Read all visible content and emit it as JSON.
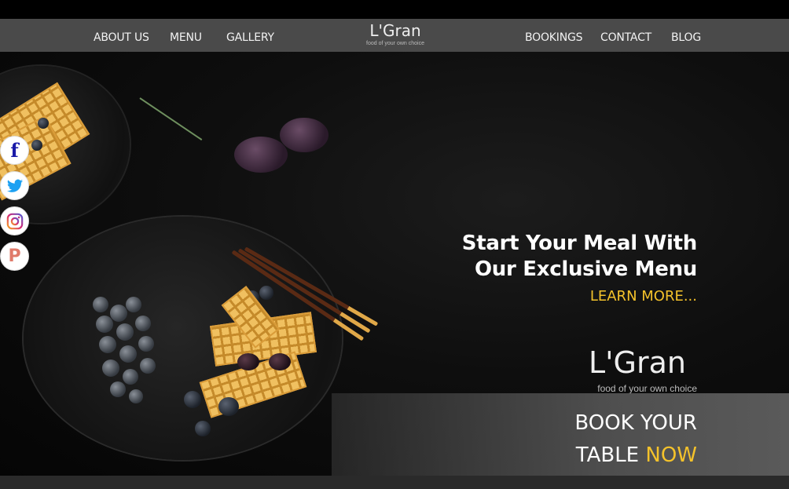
{
  "nav": {
    "left_items": [
      "ABOUT US",
      "MENU",
      "GALLERY"
    ],
    "right_items": [
      "BOOKINGS",
      "CONTACT",
      "BLOG"
    ],
    "brand_name": "L'Gran",
    "brand_tagline": "food of your own choice"
  },
  "social": [
    {
      "name": "facebook",
      "icon": "facebook-icon",
      "color": "#1a1aa8"
    },
    {
      "name": "twitter",
      "icon": "twitter-icon",
      "color": "#1da1f2"
    },
    {
      "name": "instagram",
      "icon": "instagram-icon",
      "color": "#c13584"
    },
    {
      "name": "pinterest",
      "icon": "pinterest-icon",
      "color": "#e07a6a"
    }
  ],
  "hero": {
    "title_line1": "Start Your Meal With",
    "title_line2": "Our Exclusive Menu",
    "learn_more": "LEARN MORE...",
    "logo_name": "L'Gran",
    "logo_tagline": "food of your own choice"
  },
  "booking": {
    "line1": "BOOK YOUR",
    "line2_prefix": "TABLE",
    "line2_highlight": "NOW"
  },
  "colors": {
    "accent": "#f4c22b",
    "navbar": "#4a4a4a",
    "background": "#000000"
  }
}
